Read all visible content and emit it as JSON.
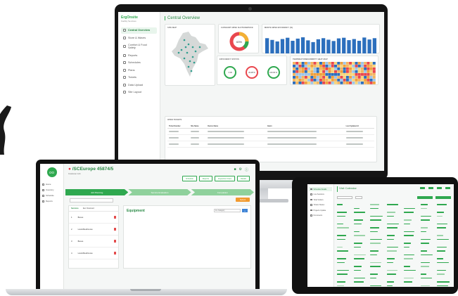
{
  "imac": {
    "logo_line1": "ErgOnsite",
    "logo_line2": "Facility Services",
    "nav": [
      {
        "label": "Central Overview",
        "icon": "dashboard-icon"
      },
      {
        "label": "Store & Waves",
        "icon": "store-icon"
      },
      {
        "label": "Comfort & Food Safety",
        "icon": "shield-icon"
      },
      {
        "label": "Reports",
        "icon": "report-icon"
      },
      {
        "label": "Schedules",
        "icon": "calendar-icon"
      },
      {
        "label": "Plans",
        "icon": "plan-icon"
      },
      {
        "label": "Tickets",
        "icon": "ticket-icon"
      },
      {
        "label": "Data Upload",
        "icon": "upload-icon"
      },
      {
        "label": "Site Layout",
        "icon": "layout-icon"
      }
    ],
    "page_title": "Central Overview",
    "cards": {
      "map_title": "SITE MAP",
      "donut_title": "CATEGORY WISE SLOTS/SERVICE",
      "donut_center": "63%",
      "bar_title": "MONTH WISE EFFICIENCY (%)",
      "gauges_title": "EFFICIENCY STATUS",
      "gauges": [
        {
          "value": "0.00",
          "color": "#2fa84f"
        },
        {
          "value": "29.28 %",
          "color": "#e9474e"
        },
        {
          "value": "100.00 %",
          "color": "#2fa84f"
        }
      ],
      "heatmap_title": "TEMPERATURE/HUMIDITY HEAT MAP",
      "tickets_title": "OPEN TICKETS",
      "tickets_columns": [
        "Ticket Number",
        "Site Name",
        "Device Name",
        "Alarm",
        "Last Updated At"
      ]
    },
    "bar_values": [
      70,
      62,
      55,
      66,
      72,
      58,
      68,
      74,
      60,
      52,
      65,
      70,
      63,
      57,
      69,
      72,
      61,
      66,
      58,
      73,
      64,
      70
    ],
    "accent": "#2fa84f",
    "bar_color": "#2c6fbd"
  },
  "laptop": {
    "avatar_initials": "OO",
    "nav": [
      {
        "label": "Home",
        "icon": "home-icon"
      },
      {
        "label": "Inventory",
        "icon": "box-icon"
      },
      {
        "label": "Schedule",
        "icon": "calendar-icon"
      },
      {
        "label": "Reports",
        "icon": "report-icon"
      }
    ],
    "job_title": "/SCEurope 45874/5",
    "job_sub": "Customer Job",
    "top_buttons": [
      "Schedule",
      "Reports",
      "Inspection Clues",
      "Details"
    ],
    "steps": [
      "Job Planning",
      "Service Evaluation",
      "Completion"
    ],
    "orange_button": "Submit",
    "list_headers": [
      "Services",
      "Item Scanned"
    ],
    "list_items": [
      {
        "num": "1",
        "name": "Boxes"
      },
      {
        "num": "2",
        "name": "LoHo/Medi/cures"
      },
      {
        "num": "3",
        "name": "Boxes"
      },
      {
        "num": "4",
        "name": "LoHo/Medi/cures"
      }
    ],
    "equipment_title": "Equipment",
    "select_value": "Ice Category"
  },
  "tablet": {
    "nav": [
      {
        "label": "Schedule Details",
        "icon": "calendar-icon"
      },
      {
        "label": "Live Sessions",
        "icon": "session-icon"
      },
      {
        "label": "Total Visitors",
        "icon": "user-icon"
      },
      {
        "label": "Tickets Status",
        "icon": "ticket-icon"
      },
      {
        "label": "Projects Update",
        "icon": "project-icon"
      },
      {
        "label": "Documents",
        "icon": "doc-icon"
      }
    ],
    "page_title": "Visit Calendar"
  }
}
